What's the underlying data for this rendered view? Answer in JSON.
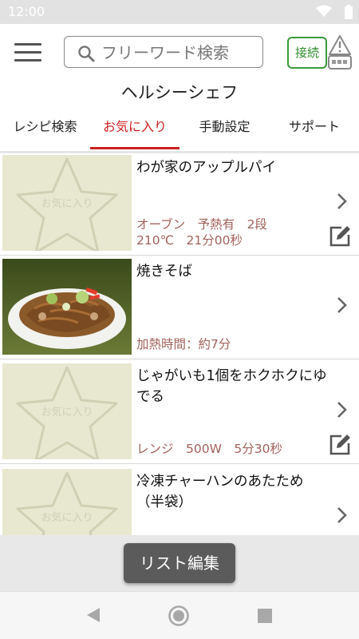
{
  "status_bar": {
    "time": "12:00",
    "wifi_icon": "wifi-icon",
    "battery_icon": "battery-icon"
  },
  "header": {
    "menu_icon": "hamburger-menu-icon",
    "search": {
      "placeholder": "フリーワード検索",
      "icon": "search-icon"
    },
    "connect_label": "接続",
    "device_status_icon": "device-warning-icon",
    "app_title": "ヘルシーシェフ"
  },
  "tabs": [
    {
      "label": "レシピ検索",
      "active": false
    },
    {
      "label": "お気に入り",
      "active": true
    },
    {
      "label": "手動設定",
      "active": false
    },
    {
      "label": "サポート",
      "active": false
    }
  ],
  "favorites": [
    {
      "title": "わが家のアップルパイ",
      "meta_line1": "オーブン　予熱有　2段",
      "meta_line2": "210℃　21分00秒",
      "has_photo": false,
      "placeholder_label": "お気に入り",
      "editable": true
    },
    {
      "title": "焼きそば",
      "meta_line1": "加熱時間：約7分",
      "meta_line2": "",
      "has_photo": true,
      "placeholder_label": "",
      "editable": false
    },
    {
      "title": "じゃがいも1個をホクホクにゆでる",
      "meta_line1": "レンジ　500W　5分30秒",
      "meta_line2": "",
      "has_photo": false,
      "placeholder_label": "お気に入り",
      "editable": true
    },
    {
      "title": "冷凍チャーハンのあたため（半袋）",
      "meta_line1": "",
      "meta_line2": "",
      "has_photo": false,
      "placeholder_label": "お気に入り",
      "editable": false
    }
  ],
  "footer": {
    "edit_list_label": "リスト編集"
  },
  "nav_bar": {
    "back_icon": "back-triangle-icon",
    "home_icon": "home-circle-icon",
    "recent_icon": "recent-apps-square-icon"
  },
  "colors": {
    "accent_red": "#cc1f1f",
    "meta_brown": "#a2625c",
    "connect_green": "#2e8b2e",
    "placeholder_bg": "#e8e8d0"
  }
}
